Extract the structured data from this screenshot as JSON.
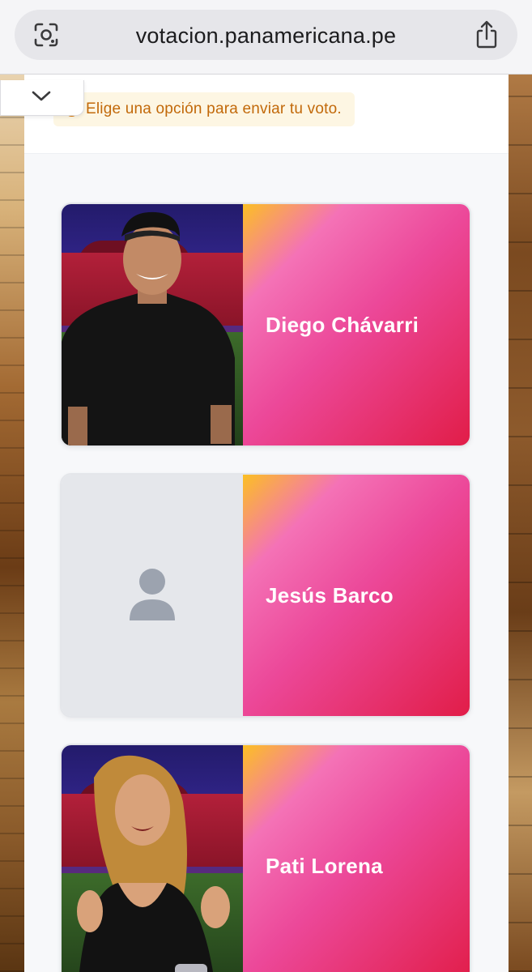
{
  "browser": {
    "url": "votacion.panamericana.pe",
    "left_icon": "lens-icon",
    "right_icon": "share-icon"
  },
  "hint": {
    "text": "Elige una opción para enviar tu voto."
  },
  "collapse": {
    "icon": "chevron-down-icon"
  },
  "candidates": [
    {
      "name": "Diego Chávarri",
      "has_photo": true
    },
    {
      "name": "Jesús Barco",
      "has_photo": false
    },
    {
      "name": "Pati Lorena",
      "has_photo": true
    }
  ],
  "colors": {
    "gradient_start": "#fbbf24",
    "gradient_mid": "#ec4899",
    "gradient_end": "#e11d48",
    "hint_text": "#c2690a",
    "hint_bg": "#fdf6e3"
  }
}
